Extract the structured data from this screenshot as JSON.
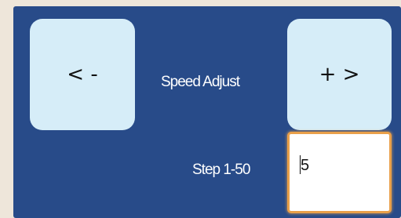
{
  "controls": {
    "decrease_label": "< -",
    "increase_label": "+ >",
    "speed_label": "Speed Adjust",
    "step_label": "Step 1-50",
    "step_value": "5"
  },
  "colors": {
    "panel_background": "#284b89",
    "button_background": "#d6edf8",
    "input_focus_border": "#e9a04a",
    "page_background": "#eee6da"
  }
}
